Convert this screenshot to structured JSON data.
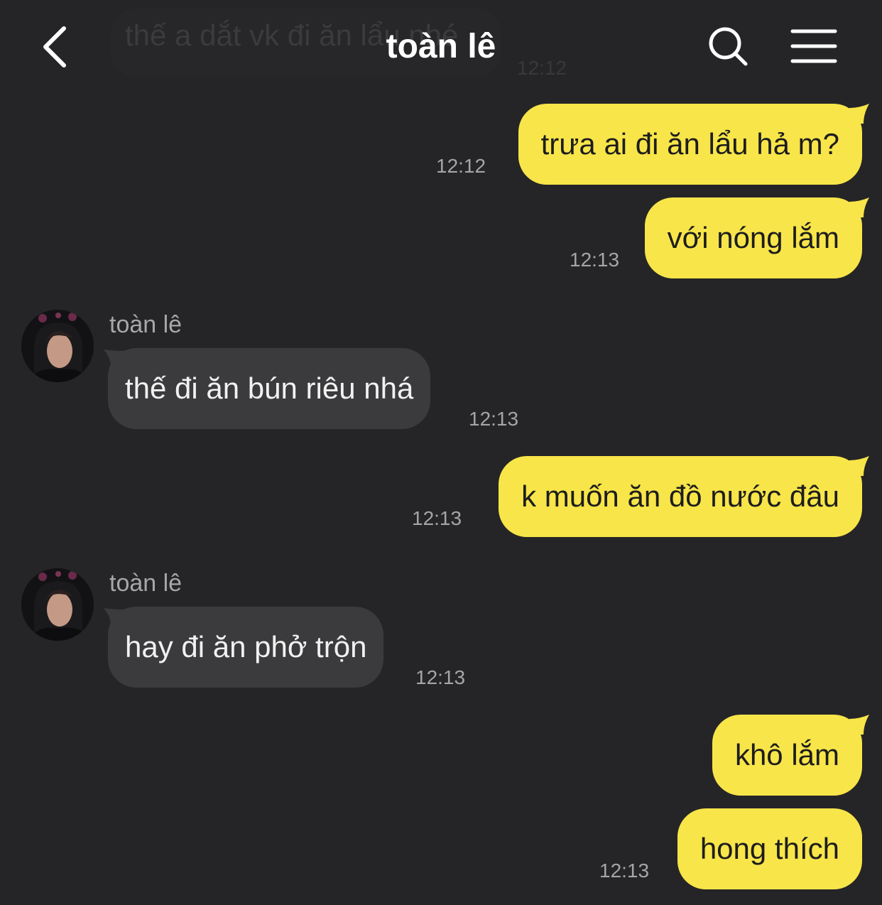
{
  "header": {
    "title": "toàn lê"
  },
  "ghost_message": {
    "text": "thế a dắt vk đi ăn lẩu nhé",
    "time": "12:12"
  },
  "messages": [
    {
      "text": "trưa ai đi ăn lẩu hả m?",
      "time": "12:12",
      "direction": "out"
    },
    {
      "text": "với nóng lắm",
      "time": "12:13",
      "direction": "out"
    },
    {
      "sender": "toàn lê",
      "text": "thế đi ăn bún riêu nhá",
      "time": "12:13",
      "direction": "in"
    },
    {
      "text": "k muốn ăn đồ nước đâu",
      "time": "12:13",
      "direction": "out"
    },
    {
      "sender": "toàn lê",
      "text": "hay đi ăn phở trộn",
      "time": "12:13",
      "direction": "in"
    },
    {
      "text": "khô lắm",
      "direction": "out"
    },
    {
      "text": "hong thích",
      "time": "12:13",
      "direction": "out"
    }
  ],
  "colors": {
    "background": "#252527",
    "outgoing_bubble": "#f8e549",
    "incoming_bubble": "#3b3b3d",
    "timestamp": "#a5a5a7"
  },
  "icons": {
    "back": "chevron-left-icon",
    "search": "search-icon",
    "menu": "hamburger-menu-icon"
  }
}
